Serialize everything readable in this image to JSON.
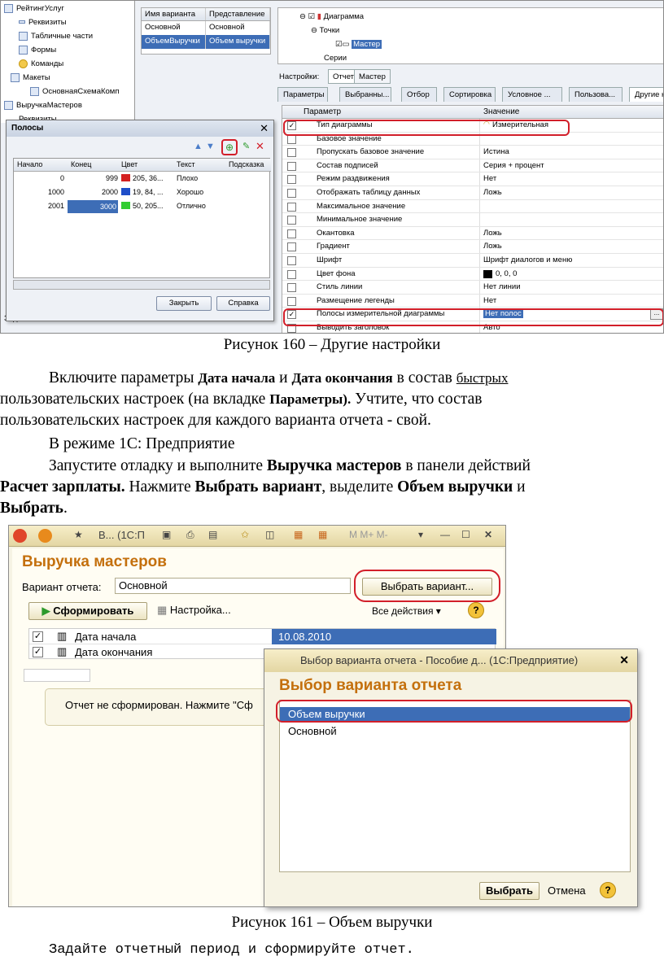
{
  "figure1": {
    "tree": [
      "РейтингУслуг",
      "Реквизиты",
      "Табличные части",
      "Формы",
      "Команды",
      "Макеты",
      "ОсновнаяСхемаКомп",
      "ВыручкаМастеров",
      "Реквизиты",
      "Задачи"
    ],
    "variants": {
      "headers": [
        "Имя варианта",
        "Представление"
      ],
      "rows": [
        [
          "Основной",
          "Основной"
        ],
        [
          "ОбъемВыручки",
          "Объем выручки"
        ]
      ]
    },
    "structure": {
      "diagram": "Диаграмма",
      "points": "Точки",
      "master": "Мастер",
      "series": "Серии"
    },
    "settings_label": "Настройки:",
    "top_tabs": [
      "Отчет",
      "Мастер"
    ],
    "tabs": [
      "Параметры",
      "Выбранны...",
      "Отбор",
      "Сортировка",
      "Условное ...",
      "Пользова...",
      "Другие н"
    ],
    "grid_headers": [
      "Параметр",
      "Значение"
    ],
    "params": [
      {
        "p": "Тип диаграммы",
        "v": "Измерительная",
        "c": true
      },
      {
        "p": "Базовое значение",
        "v": "",
        "c": false
      },
      {
        "p": "Пропускать базовое значение",
        "v": "Истина",
        "c": false
      },
      {
        "p": "Состав подписей",
        "v": "Серия + процент",
        "c": false
      },
      {
        "p": "Режим раздвижения",
        "v": "Нет",
        "c": false
      },
      {
        "p": "Отображать таблицу данных",
        "v": "Ложь",
        "c": false
      },
      {
        "p": "Максимальное значение",
        "v": "",
        "c": false
      },
      {
        "p": "Минимальное значение",
        "v": "",
        "c": false
      },
      {
        "p": "Окантовка",
        "v": "Ложь",
        "c": false
      },
      {
        "p": "Градиент",
        "v": "Ложь",
        "c": false
      },
      {
        "p": "Шрифт",
        "v": "Шрифт диалогов и меню",
        "c": false
      },
      {
        "p": "Цвет фона",
        "v": "0, 0, 0",
        "c": false
      },
      {
        "p": "Стиль линии",
        "v": "Нет линии",
        "c": false
      },
      {
        "p": "Размещение легенды",
        "v": "Нет",
        "c": false
      },
      {
        "p": "Полосы измерительной диаграммы",
        "v": "Нет полос",
        "c": true
      },
      {
        "p": "Выводить заголовок",
        "v": "Авто",
        "c": false
      }
    ],
    "polosy": {
      "title": "Полосы",
      "headers": [
        "Начало",
        "Конец",
        "Цвет",
        "Текст",
        "Подсказка"
      ],
      "rows": [
        {
          "start": "0",
          "end": "999",
          "color": "205, 36...",
          "swatch": "#d42020",
          "text": "Плохо"
        },
        {
          "start": "1000",
          "end": "2000",
          "color": "19, 84, ...",
          "swatch": "#1f4ec9",
          "text": "Хорошо"
        },
        {
          "start": "2001",
          "end": "3000",
          "color": "50, 205...",
          "swatch": "#32cd32",
          "text": "Отлично"
        }
      ],
      "close": "Закрыть",
      "help": "Справка"
    }
  },
  "caption1": "Рисунок 160 – Другие настройки",
  "para1": {
    "a": "Включите параметры ",
    "b": "Дата начала",
    "c": " и ",
    "d": "Дата окончания",
    "e": " в состав ",
    "f": "быстрых",
    "g": "пользовательских настроек (на вкладке ",
    "h": "Параметры).",
    "i": " Учтите, что состав",
    "j": "пользовательских настроек для каждого варианта отчета - свой."
  },
  "para2": "В режиме 1С: Предприятие",
  "para3": {
    "a": "Запустите отладку и выполните ",
    "b": "Выручка мастеров",
    "c": " в панели действий",
    "d": "Расчет зарплаты.",
    "e": " Нажмите ",
    "f": "Выбрать вариант",
    "g": ", выделите ",
    "h": "Объем выручки",
    "i": " и",
    "j": "Выбрать",
    "k": "."
  },
  "figure2": {
    "toolbar_text": "В...  (1С:П",
    "mem": "M  M+  M-",
    "title": "Выручка мастеров",
    "variant_label": "Вариант отчета:",
    "variant_value": "Основной",
    "choose_btn": "Выбрать вариант...",
    "form_btn": "Сформировать",
    "settings_btn": "Настройка...",
    "all_actions": "Все действия ▾",
    "rows": [
      {
        "name": "Дата начала",
        "value": "10.08.2010"
      },
      {
        "name": "Дата окончания",
        "value": ""
      }
    ],
    "message": "Отчет не сформирован. Нажмите \"Сф",
    "dialog": {
      "title": "Выбор варианта отчета - Пособие д... (1С:Предприятие)",
      "heading": "Выбор варианта отчета",
      "items": [
        "Объем выручки",
        "Основной"
      ],
      "ok": "Выбрать",
      "cancel": "Отмена"
    }
  },
  "caption2": "Рисунок 161 – Объем выручки",
  "para4": "Задайте отчетный период и сформируйте отчет."
}
